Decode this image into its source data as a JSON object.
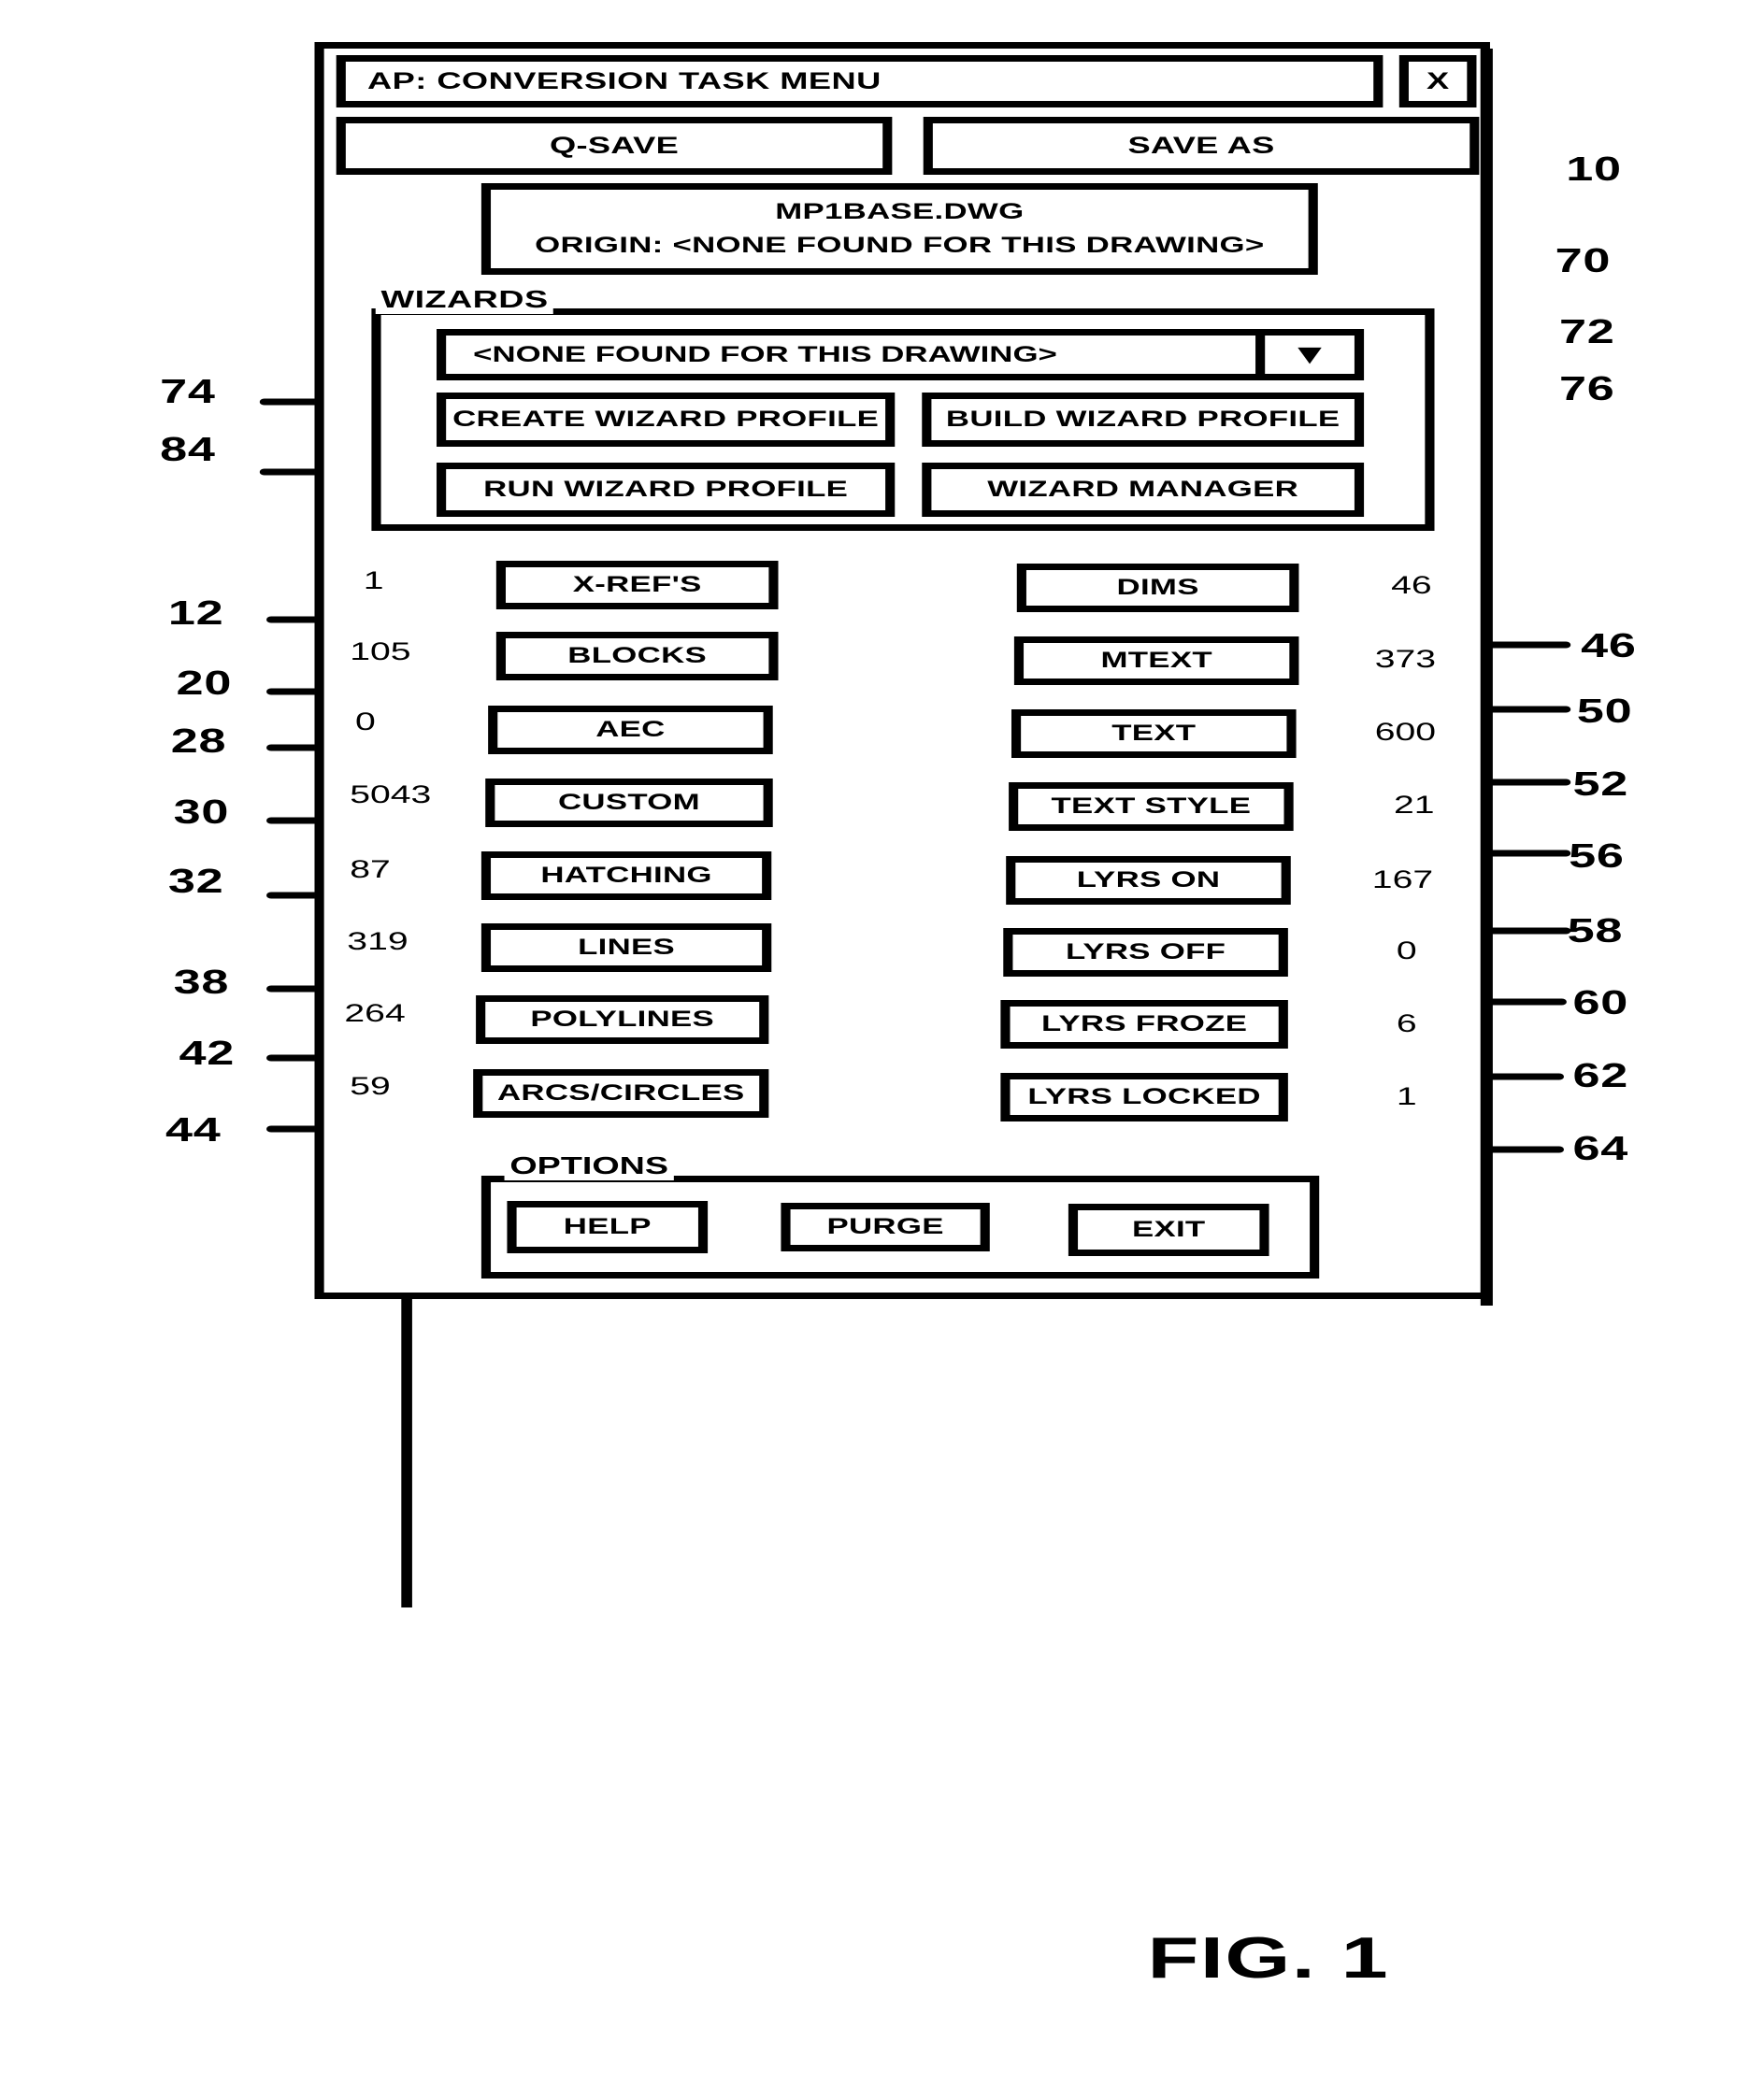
{
  "figure": {
    "caption": "FIG. 1"
  },
  "dialog": {
    "title": "AP: CONVERSION TASK MENU",
    "close_label": "X",
    "close_icon": "close-icon",
    "toolbar": {
      "qsave_label": "Q-SAVE",
      "saveas_label": "SAVE AS"
    },
    "file_info": {
      "filename": "MP1BASE.DWG",
      "origin": "ORIGIN: <NONE FOUND FOR THIS DRAWING>"
    },
    "wizards": {
      "group_label": "WIZARDS",
      "select_value": "<NONE FOUND FOR THIS DRAWING>",
      "dropdown_icon": "▼",
      "create_label": "CREATE WIZARD PROFILE",
      "build_label": "BUILD WIZARD PROFILE",
      "run_label": "RUN WIZARD PROFILE",
      "manager_label": "WIZARD MANAGER"
    },
    "entities_left": [
      {
        "label": "X-REF'S",
        "count": "1",
        "ref": "12"
      },
      {
        "label": "BLOCKS",
        "count": "105",
        "ref": "20"
      },
      {
        "label": "AEC",
        "count": "0",
        "ref": "28"
      },
      {
        "label": "CUSTOM",
        "count": "5043",
        "ref": "30"
      },
      {
        "label": "HATCHING",
        "count": "87",
        "ref": "32"
      },
      {
        "label": "LINES",
        "count": "319",
        "ref": "38"
      },
      {
        "label": "POLYLINES",
        "count": "264",
        "ref": "42"
      },
      {
        "label": "ARCS/CIRCLES",
        "count": "59",
        "ref": "44"
      }
    ],
    "entities_right": [
      {
        "label": "DIMS",
        "count": "46",
        "ref": "46"
      },
      {
        "label": "MTEXT",
        "count": "373",
        "ref": "50"
      },
      {
        "label": "TEXT",
        "count": "600",
        "ref": "52"
      },
      {
        "label": "TEXT STYLE",
        "count": "21",
        "ref": "56"
      },
      {
        "label": "LYRS ON",
        "count": "167",
        "ref": "58"
      },
      {
        "label": "LYRS OFF",
        "count": "0",
        "ref": "60"
      },
      {
        "label": "LYRS FROZE",
        "count": "6",
        "ref": "62"
      },
      {
        "label": "LYRS LOCKED",
        "count": "1",
        "ref": "64"
      }
    ],
    "options": {
      "group_label": "OPTIONS",
      "help_label": "HELP",
      "purge_label": "PURGE",
      "exit_label": "EXIT"
    }
  },
  "callouts": {
    "dialog_ref": "10",
    "wizards_group_ref": "70",
    "wizard_select_ref": "72",
    "create_wizard_ref": "74",
    "build_wizard_ref": "76",
    "run_wizard_ref": "84"
  },
  "colors": {
    "ink": "#000000",
    "paper": "#ffffff"
  }
}
